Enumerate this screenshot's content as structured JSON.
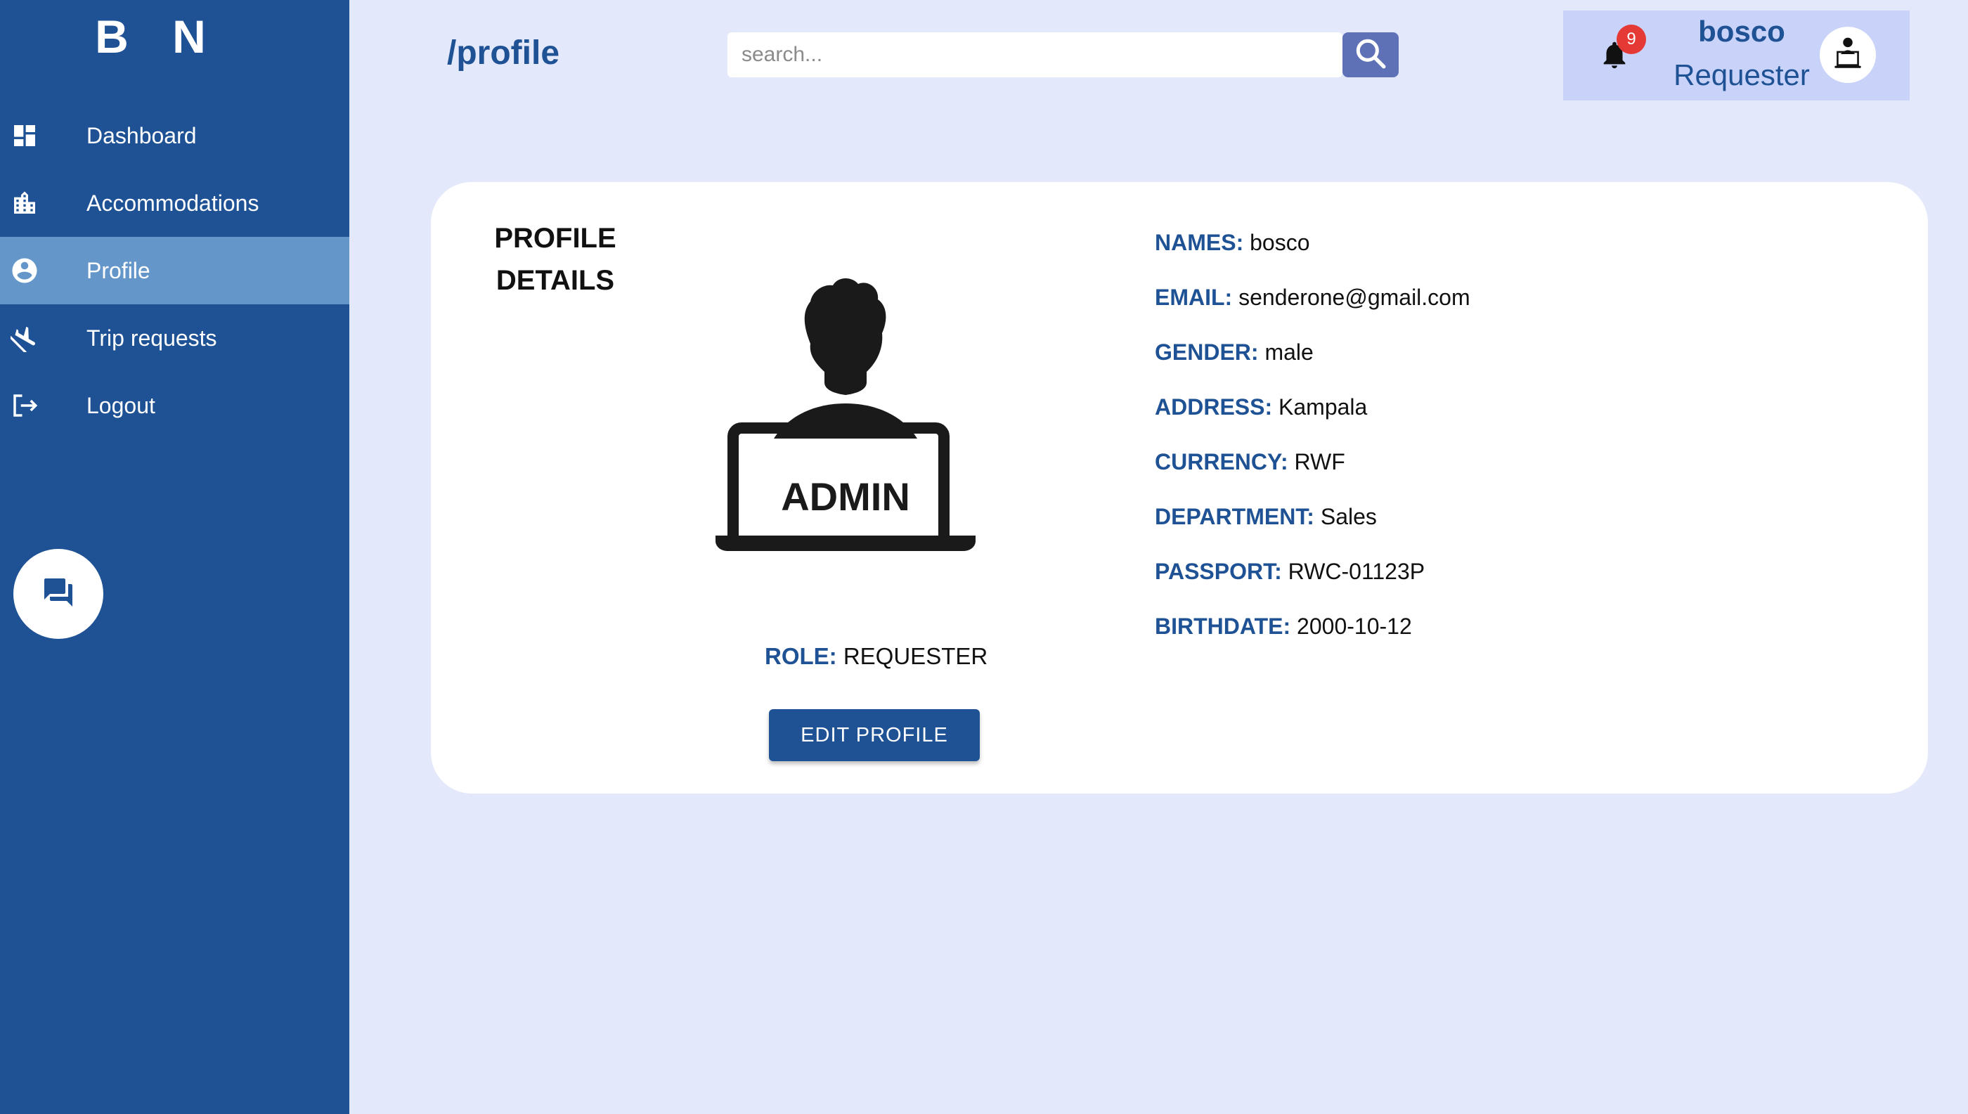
{
  "sidebar": {
    "brand": "B N",
    "items": [
      {
        "label": "Dashboard",
        "icon": "dashboard-icon"
      },
      {
        "label": "Accommodations",
        "icon": "building-icon"
      },
      {
        "label": "Profile",
        "icon": "account-circle-icon",
        "active": true
      },
      {
        "label": "Trip requests",
        "icon": "flight-icon"
      },
      {
        "label": "Logout",
        "icon": "logout-icon"
      }
    ],
    "chat_icon": "chat-icon"
  },
  "header": {
    "path": "/profile",
    "search": {
      "placeholder": "search...",
      "value": ""
    },
    "notifications_count": "9",
    "user": {
      "name": "bosco",
      "role": "Requester"
    }
  },
  "profile": {
    "title": "PROFILE\nDETAILS",
    "image_text": "ADMIN",
    "role_label": "ROLE:",
    "role_value": "REQUESTER",
    "edit_button": "EDIT PROFILE",
    "fields": [
      {
        "label": "NAMES:",
        "value": "bosco"
      },
      {
        "label": "EMAIL:",
        "value": "senderone@gmail.com"
      },
      {
        "label": "GENDER:",
        "value": "male"
      },
      {
        "label": "ADDRESS:",
        "value": "Kampala"
      },
      {
        "label": "CURRENCY:",
        "value": "RWF"
      },
      {
        "label": "DEPARTMENT:",
        "value": "Sales"
      },
      {
        "label": "PASSPORT:",
        "value": "RWC-01123P"
      },
      {
        "label": "BIRTHDATE:",
        "value": "2000-10-12"
      }
    ]
  },
  "colors": {
    "sidebar": "#1e5295",
    "sidebar_active": "#6596c9",
    "page_bg": "#e3e8fb",
    "user_box": "#c9d2f8",
    "search_button": "#5e71b6",
    "badge": "#e53935"
  }
}
